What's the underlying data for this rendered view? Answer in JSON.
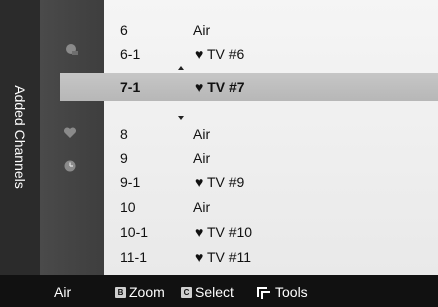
{
  "side_tab": {
    "label": "Added Channels"
  },
  "channels": [
    {
      "number": "6",
      "name": "Air",
      "favorite": false
    },
    {
      "number": "6-1",
      "name": "TV #6",
      "favorite": true
    },
    {
      "number": "7-1",
      "name": "TV #7",
      "favorite": true,
      "selected": true
    },
    {
      "number": "8",
      "name": "Air",
      "favorite": false
    },
    {
      "number": "9",
      "name": "Air",
      "favorite": false
    },
    {
      "number": "9-1",
      "name": "TV #9",
      "favorite": true
    },
    {
      "number": "10",
      "name": "Air",
      "favorite": false
    },
    {
      "number": "10-1",
      "name": "TV #10",
      "favorite": true
    },
    {
      "number": "11-1",
      "name": "TV #11",
      "favorite": true
    }
  ],
  "heart_glyph": "♥",
  "icons": [
    "satellite-icon",
    "add-channel-icon",
    "heart-icon",
    "clock-icon"
  ],
  "footer": {
    "mode": "Air",
    "zoom_key": "B",
    "zoom_label": "Zoom",
    "select_key": "C",
    "select_label": "Select",
    "tools_label": "Tools"
  },
  "colors": {
    "highlight": "#c0c0c0",
    "list_bg": "#f2f2f2",
    "footer_bg": "#111111"
  }
}
